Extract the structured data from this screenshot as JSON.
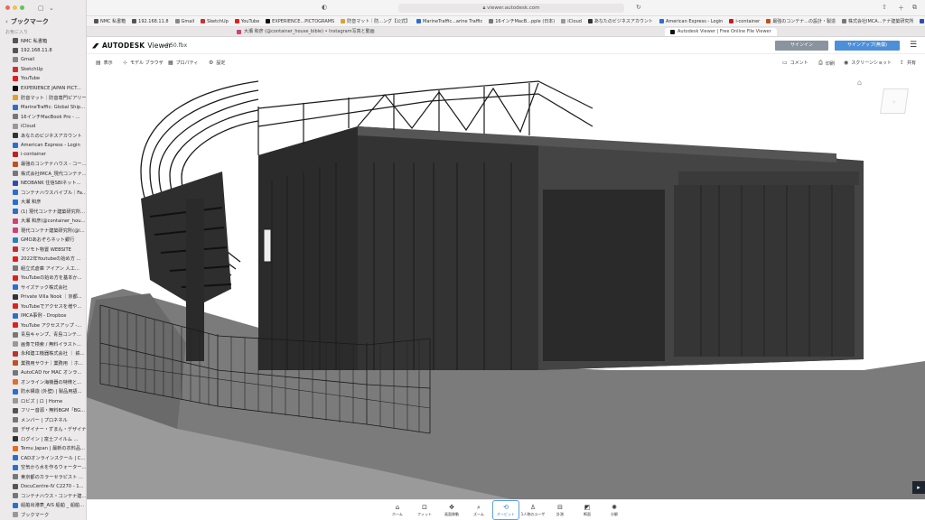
{
  "sidebar": {
    "title": "ブックマーク",
    "section": "お気に入り",
    "items": [
      {
        "label": "NMC 私書箱",
        "color": "#555555"
      },
      {
        "label": "192.168.11.8",
        "color": "#555555"
      },
      {
        "label": "Gmail",
        "color": "#888888"
      },
      {
        "label": "SketchUp",
        "color": "#c83232"
      },
      {
        "label": "YouTube",
        "color": "#e02020"
      },
      {
        "label": "EXPERIENCE JAPAN PICT...",
        "color": "#111111"
      },
      {
        "label": "防音マット｜防音専門ピアリー...",
        "color": "#e0a030"
      },
      {
        "label": "MarineTraffic: Global Ship...",
        "color": "#2a6fd0"
      },
      {
        "label": "16インチMacBook Pro - ...",
        "color": "#777777"
      },
      {
        "label": "iCloud",
        "color": "#999999"
      },
      {
        "label": "あなたのビジネスアカウント",
        "color": "#333333"
      },
      {
        "label": "American Express - Login",
        "color": "#2a6fd0"
      },
      {
        "label": "i-container",
        "color": "#c02020"
      },
      {
        "label": "最強のコンテナハウス - コー...",
        "color": "#c05020"
      },
      {
        "label": "株式会社IMCA_現代コンテナ...",
        "color": "#777777"
      },
      {
        "label": "NEOBANK 住信SBIネット...",
        "color": "#2a4fb0"
      },
      {
        "label": "コンテナハウスバイブル｜Fa...",
        "color": "#2a6fd0"
      },
      {
        "label": "大瀬 和彦",
        "color": "#2a6fd0"
      },
      {
        "label": "(1) 現代コンテナ建築研究所...",
        "color": "#2a6fd0"
      },
      {
        "label": "大瀬 和彦(@container_hou...",
        "color": "#d0407a"
      },
      {
        "label": "現代コンテナ建築研究所(@i...",
        "color": "#d0407a"
      },
      {
        "label": "GMOあおぞらネット銀行",
        "color": "#2a80c0"
      },
      {
        "label": "マツモト物置 WEBSITE",
        "color": "#c03030"
      },
      {
        "label": "2022年Youtubeの始め方 ...",
        "color": "#e02020"
      },
      {
        "label": "組立式倉庫 アイアン 人工...",
        "color": "#777777"
      },
      {
        "label": "YouTubeの始め方を基本か...",
        "color": "#e02020"
      },
      {
        "label": "サイズテック株式会社",
        "color": "#2a6fd0"
      },
      {
        "label": "Private Villa Nook ｜京都...",
        "color": "#333333"
      },
      {
        "label": "YouTubeでアクセスを増や...",
        "color": "#e02020"
      },
      {
        "label": "IMCA事例 - Dropbox",
        "color": "#2a6fd0"
      },
      {
        "label": "YouTube アクセスアップ -...",
        "color": "#e02020"
      },
      {
        "label": "青島キャンプ、青島コンテ...",
        "color": "#777777"
      },
      {
        "label": "画像で検索 / 無料イラスト...",
        "color": "#999999"
      },
      {
        "label": "永和建工機器株式会社 ｜ 鉄...",
        "color": "#c03030"
      },
      {
        "label": "業務用サウナ｜業務用 ｜ホ...",
        "color": "#c05020"
      },
      {
        "label": "AutoCAD for MAC オンラ...",
        "color": "#777777"
      },
      {
        "label": "オンライン海機器の特徴と...",
        "color": "#e07030"
      },
      {
        "label": "防水構造 (外壁) | 製品用語...",
        "color": "#2a6fd0"
      },
      {
        "label": "ロビズ | ロ | Home",
        "color": "#999999"
      },
      {
        "label": "フリー音源・無料BGM「BG...",
        "color": "#555555"
      },
      {
        "label": "メンバー | プロネネル",
        "color": "#777777"
      },
      {
        "label": "デザイナー・ずまん・デザイナ...",
        "color": "#777777"
      },
      {
        "label": "ログイン | 富士フイルム ...",
        "color": "#333333"
      },
      {
        "label": "Temu Japan | 最新の衣料品...",
        "color": "#e07020"
      },
      {
        "label": "CADオンラインスクール | C...",
        "color": "#2a6fd0"
      },
      {
        "label": "空気から水を作るウォーター...",
        "color": "#2a6fd0"
      },
      {
        "label": "東京都のカラーセラピスト ...",
        "color": "#777777"
      },
      {
        "label": "DocuCentre-IV C2270 - 1...",
        "color": "#555555"
      },
      {
        "label": "コンテナハウス・コンテナ建...",
        "color": "#777777"
      },
      {
        "label": "船舶出港表_AIS 船舶 _ 船舶...",
        "color": "#2a6fd0"
      },
      {
        "label": "ブックマーク",
        "color": "#999999"
      }
    ]
  },
  "browser": {
    "url": "viewer.autodesk.com",
    "bookmarks": [
      {
        "label": "NMC 私書箱",
        "color": "#555555"
      },
      {
        "label": "192.168.11.8",
        "color": "#555555"
      },
      {
        "label": "Gmail",
        "color": "#888888"
      },
      {
        "label": "SketchUp",
        "color": "#c83232"
      },
      {
        "label": "YouTube",
        "color": "#e02020"
      },
      {
        "label": "EXPERIENCE...PICTOGRAMS",
        "color": "#111111"
      },
      {
        "label": "防音マット｜防...ング【公式】",
        "color": "#e0a030"
      },
      {
        "label": "MarineTraffic...arine Traffic",
        "color": "#2a6fd0"
      },
      {
        "label": "16インチMacB...pple (日本)",
        "color": "#777777"
      },
      {
        "label": "iCloud",
        "color": "#999999"
      },
      {
        "label": "あなたのビジネスアカウント",
        "color": "#333333"
      },
      {
        "label": "American Express - Login",
        "color": "#2a6fd0"
      },
      {
        "label": "i-container",
        "color": "#c02020"
      },
      {
        "label": "最強のコンテナ...の設計・製造",
        "color": "#c05020"
      },
      {
        "label": "株式会社IMCA...テナ建築研究所",
        "color": "#777777"
      },
      {
        "label": "NEOBANK 住信SBIネット銀行",
        "color": "#2a4fb0"
      }
    ],
    "tabs": [
      {
        "label": "大瀬 和彦 (@container_house_bible) • Instagram写真と動画",
        "color": "#d0407a",
        "active": false
      },
      {
        "label": "Autodesk Viewer | Free Online File Viewer",
        "color": "#111111",
        "active": true
      }
    ]
  },
  "viewer": {
    "brand": "AUTODESK",
    "brand_suffix": "Viewer",
    "breadcrumb": "h50.fbx",
    "signin": "サインイン",
    "signup": "サインアップ(無償)",
    "toolbar_left": [
      {
        "label": "表示",
        "icon": "view-icon"
      },
      {
        "label": "モデル ブラウザ",
        "icon": "model-browser-icon"
      },
      {
        "label": "プロパティ",
        "icon": "properties-icon"
      },
      {
        "label": "設定",
        "icon": "settings-icon"
      }
    ],
    "toolbar_right": [
      {
        "label": "コメント",
        "icon": "comment-icon"
      },
      {
        "label": "印刷",
        "icon": "print-icon"
      },
      {
        "label": "スクリーンショット",
        "icon": "camera-icon"
      },
      {
        "label": "共有",
        "icon": "share-icon"
      }
    ],
    "bottom_tools": [
      {
        "label": "ホーム",
        "icon": "home-icon",
        "active": false
      },
      {
        "label": "フィット",
        "icon": "fit-icon",
        "active": false
      },
      {
        "label": "画面移動",
        "icon": "pan-icon",
        "active": false
      },
      {
        "label": "ズーム",
        "icon": "zoom-icon",
        "active": false
      },
      {
        "label": "オービット",
        "icon": "orbit-icon",
        "active": true
      },
      {
        "label": "1人称のユーザ",
        "icon": "first-person-icon",
        "active": false
      },
      {
        "label": "計測",
        "icon": "measure-icon",
        "active": false
      },
      {
        "label": "断面",
        "icon": "section-icon",
        "active": false
      },
      {
        "label": "分解",
        "icon": "explode-icon",
        "active": false
      }
    ]
  }
}
